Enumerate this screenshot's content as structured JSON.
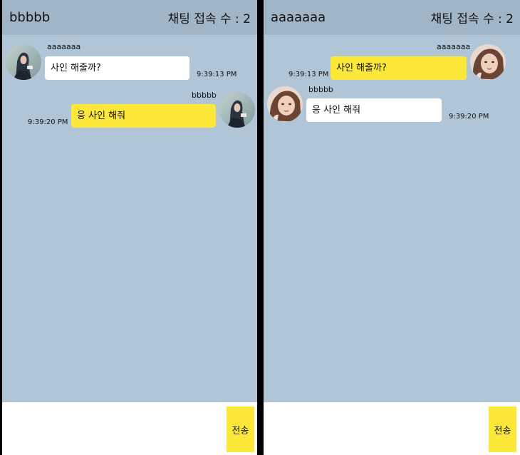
{
  "left": {
    "title": "bbbbb",
    "count_label": "채팅 접속 수 : 2",
    "messages": [
      {
        "sender": "aaaaaaa",
        "text": "사인 해줄까?",
        "time": "9:39:13 PM"
      },
      {
        "sender": "bbbbb",
        "text": "응 사인 해줘",
        "time": "9:39:20 PM"
      }
    ],
    "input_value": "",
    "send_label": "전송"
  },
  "right": {
    "title": "aaaaaaa",
    "count_label": "채팅 접속 수 : 2",
    "messages": [
      {
        "sender": "aaaaaaa",
        "text": "사인 해줄까?",
        "time": "9:39:13 PM"
      },
      {
        "sender": "bbbbb",
        "text": "응 사인 해줘",
        "time": "9:39:20 PM"
      }
    ],
    "input_value": "",
    "send_label": "전송"
  },
  "colors": {
    "chat_background": "#b0c6d6",
    "header": "#a0b5c6",
    "own_bubble": "#fde839",
    "other_bubble": "#ffffff"
  },
  "icons": {
    "avatar_bbbbb": "user-photo-hijab-icon",
    "avatar_aaaaaaa": "user-photo-woman-icon"
  }
}
